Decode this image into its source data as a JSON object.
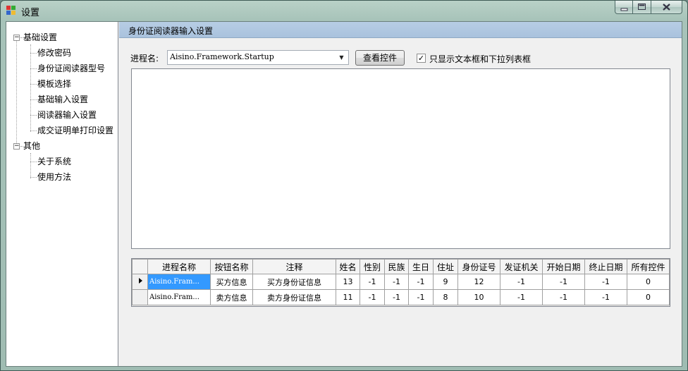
{
  "window": {
    "title": "设置"
  },
  "tree": {
    "groups": [
      {
        "label": "基础设置",
        "children": [
          "修改密码",
          "身份证阅读器型号",
          "模板选择",
          "基础输入设置",
          "阅读器输入设置",
          "成交证明单打印设置"
        ]
      },
      {
        "label": "其他",
        "children": [
          "关于系统",
          "使用方法"
        ]
      }
    ]
  },
  "panel": {
    "title": "身份证阅读器输入设置",
    "process_label": "进程名:",
    "process_value": "Aisino.Framework.Startup",
    "view_button": "查看控件",
    "only_text_checkbox": "只显示文本框和下拉列表框",
    "only_text_checked": true
  },
  "grid": {
    "columns": [
      "进程名称",
      "按钮名称",
      "注释",
      "姓名",
      "性别",
      "民族",
      "生日",
      "住址",
      "身份证号",
      "发证机关",
      "开始日期",
      "终止日期",
      "所有控件"
    ],
    "rows": [
      [
        "Aisino.Fram...",
        "买方信息",
        "买方身份证信息",
        "13",
        "-1",
        "-1",
        "-1",
        "9",
        "12",
        "-1",
        "-1",
        "-1",
        "0"
      ],
      [
        "Aisino.Fram...",
        "卖方信息",
        "卖方身份证信息",
        "11",
        "-1",
        "-1",
        "-1",
        "8",
        "10",
        "-1",
        "-1",
        "-1",
        "0"
      ]
    ]
  }
}
